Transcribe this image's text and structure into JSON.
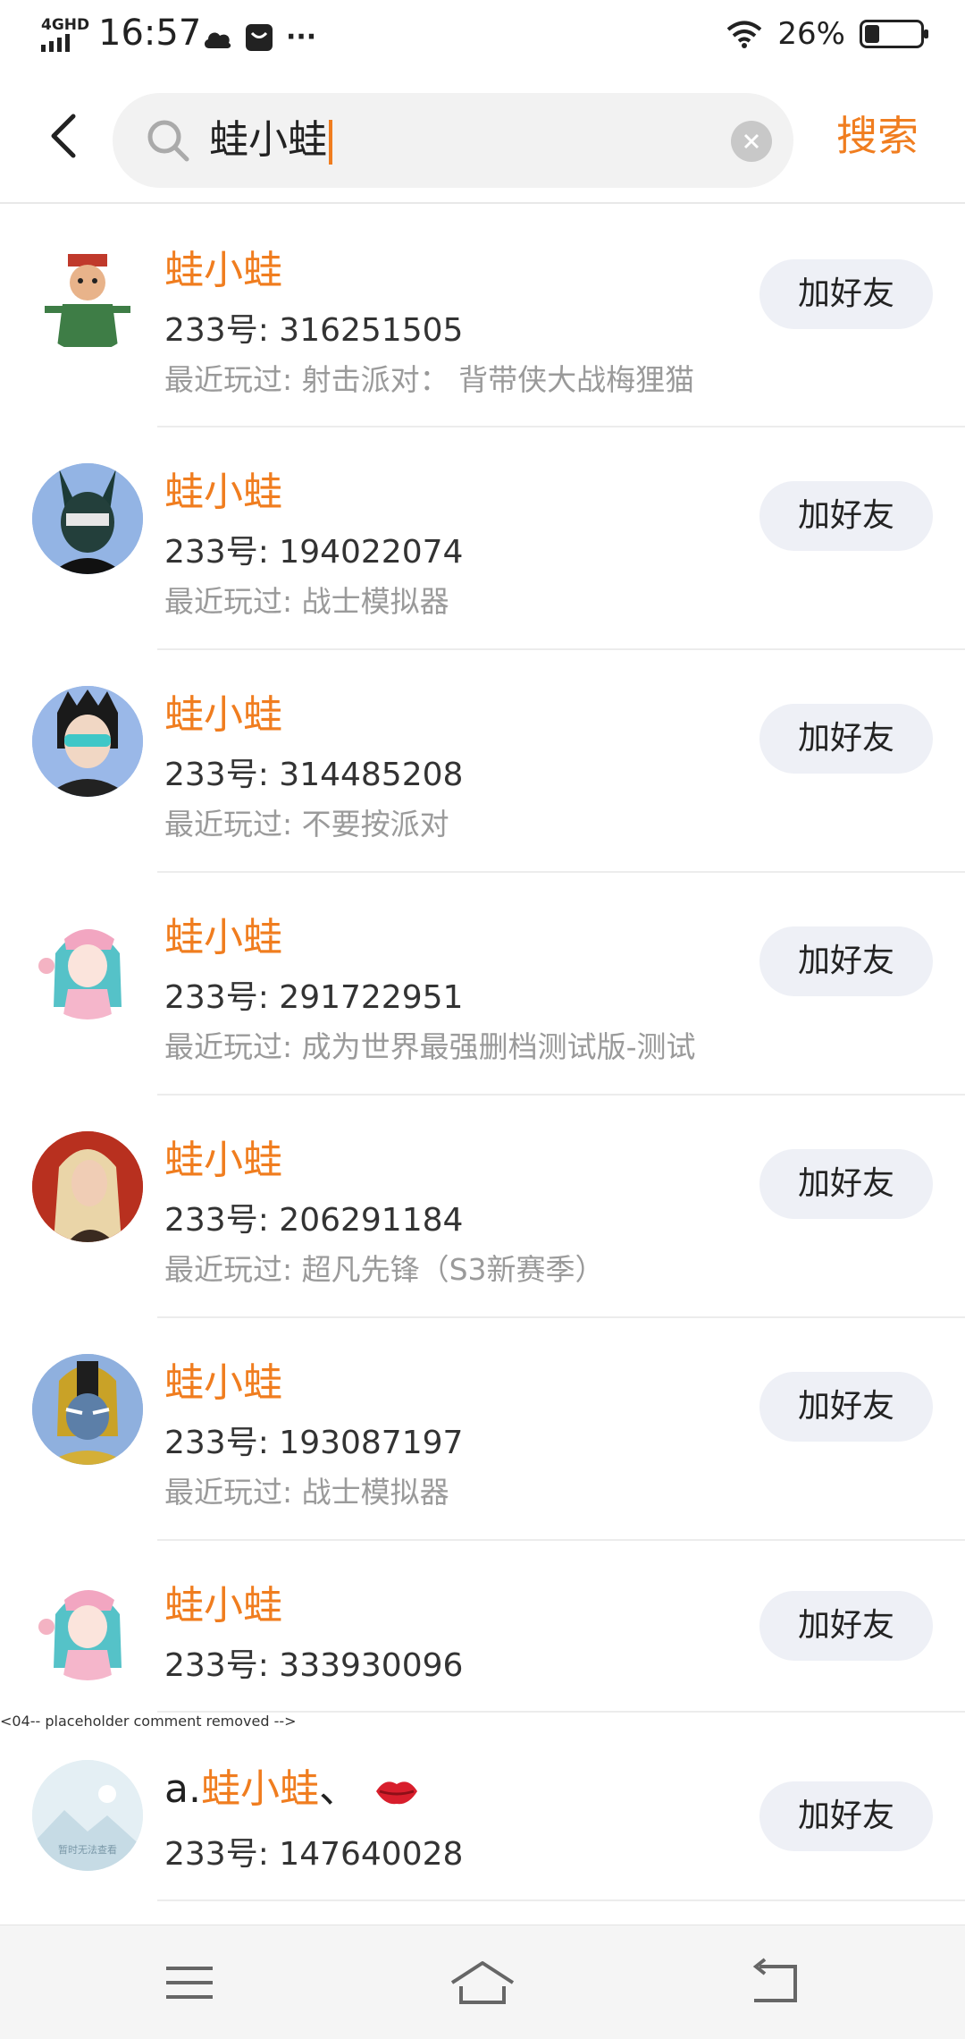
{
  "status_bar": {
    "network": "4GHD",
    "time": "16:57",
    "more": "···",
    "battery_text": "26%",
    "battery_level": 0.26
  },
  "search": {
    "query": "蛙小蛙",
    "submit_label": "搜索"
  },
  "results": [
    {
      "name": "蛙小蛙",
      "uid": "233号: 316251505",
      "played": "最近玩过: 射击派对：  背带侠大战梅狸猫",
      "add_label": "加好友"
    },
    {
      "name": "蛙小蛙",
      "uid": "233号: 194022074",
      "played": "最近玩过: 战士模拟器",
      "add_label": "加好友"
    },
    {
      "name": "蛙小蛙",
      "uid": "233号: 314485208",
      "played": "最近玩过: 不要按派对",
      "add_label": "加好友"
    },
    {
      "name": "蛙小蛙",
      "uid": "233号: 291722951",
      "played": "最近玩过: 成为世界最强删档测试版-测试",
      "add_label": "加好友"
    },
    {
      "name": "蛙小蛙",
      "uid": "233号: 206291184",
      "played": "最近玩过: 超凡先锋（S3新赛季）",
      "add_label": "加好友"
    },
    {
      "name": "蛙小蛙",
      "uid": "233号: 193087197",
      "played": "最近玩过: 战士模拟器",
      "add_label": "加好友"
    },
    {
      "name": "蛙小蛙",
      "uid": "233号: 333930096",
      "add_label": "加好友"
    },
    {
      "name_prefix": "a.",
      "name": "蛙小蛙",
      "name_suffix": "、",
      "uid": "233号: 147640028",
      "add_label": "加好友",
      "avatar_caption": "暂时无法查看"
    }
  ]
}
